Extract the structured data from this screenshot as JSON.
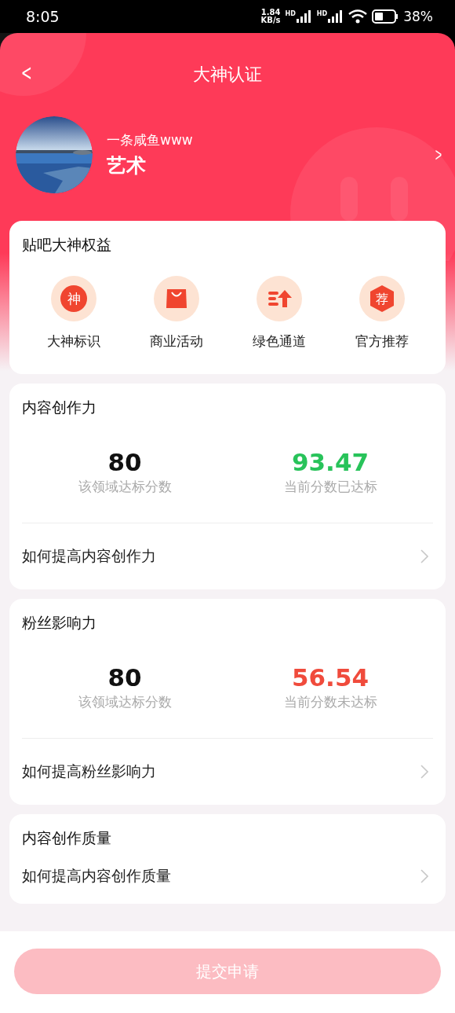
{
  "status_bar": {
    "time": "8:05",
    "speed": "1.84",
    "speed_unit": "KB/s",
    "network": [
      "HD",
      "HD"
    ],
    "battery": "38%"
  },
  "header": {
    "back": "<",
    "title": "大神认证"
  },
  "profile": {
    "name": "一条咸鱼www",
    "domain": "艺术",
    "chevron": ">"
  },
  "benefits": {
    "title": "贴吧大神权益",
    "items": [
      {
        "kind": "badge",
        "label": "大神标识",
        "glyph": "神"
      },
      {
        "kind": "bag",
        "label": "商业活动"
      },
      {
        "kind": "fast",
        "label": "绿色通道"
      },
      {
        "kind": "hexagon",
        "label": "官方推荐",
        "glyph": "荐"
      }
    ]
  },
  "sections": [
    {
      "title": "内容创作力",
      "target": "80",
      "target_label": "该领域达标分数",
      "score": "93.47",
      "score_label": "当前分数已达标",
      "met": true,
      "link": "如何提高内容创作力"
    },
    {
      "title": "粉丝影响力",
      "target": "80",
      "target_label": "该领域达标分数",
      "score": "56.54",
      "score_label": "当前分数未达标",
      "met": false,
      "link": "如何提高粉丝影响力"
    },
    {
      "title": "内容创作质量",
      "link": "如何提高内容创作质量"
    }
  ],
  "submit": {
    "label": "提交申请",
    "disabled": true
  }
}
